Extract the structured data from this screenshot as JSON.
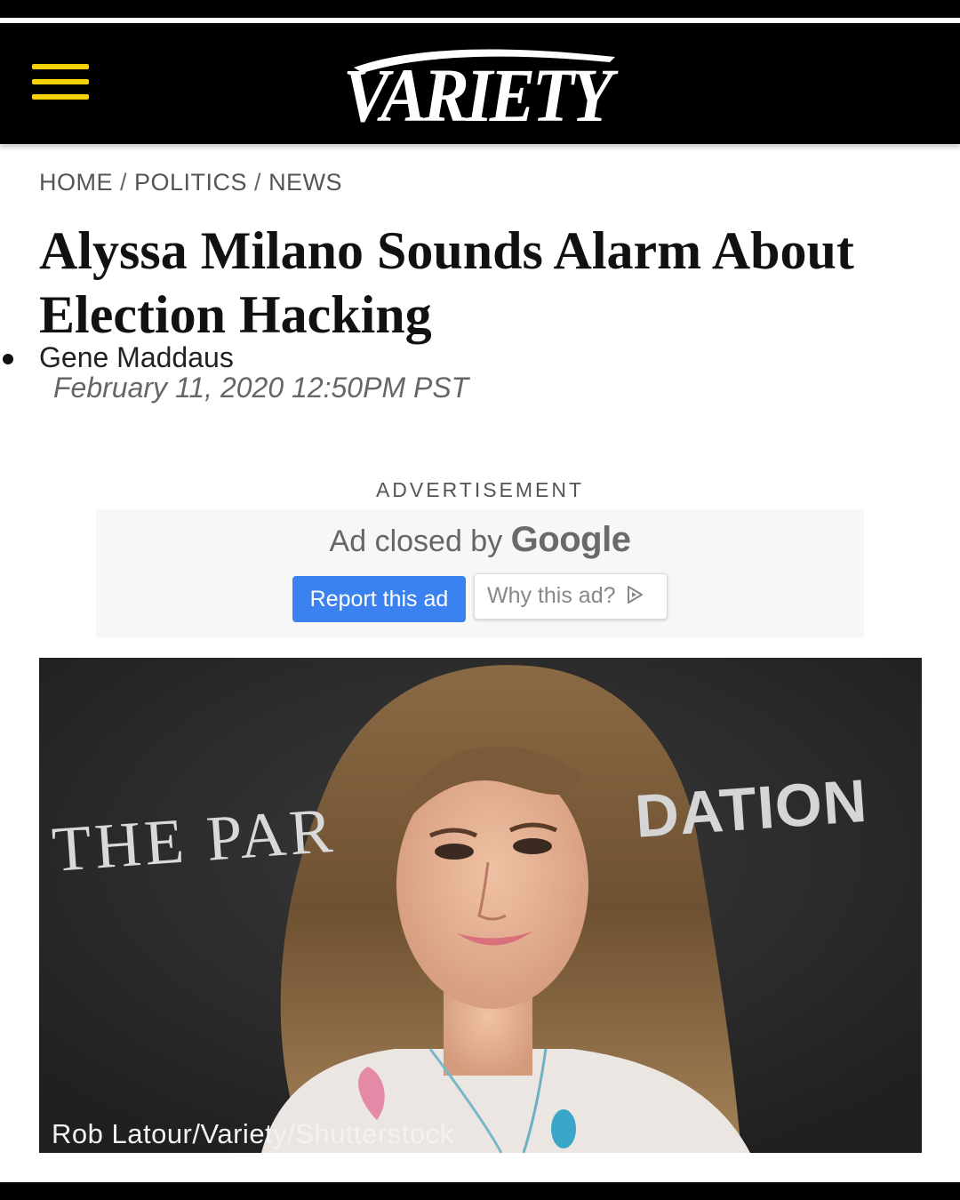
{
  "header": {
    "menu_icon": "hamburger-menu-icon",
    "logo_text": "VARIETY",
    "menu_color": "#f5d20a"
  },
  "breadcrumb": {
    "items": [
      "HOME",
      "POLITICS",
      "NEWS"
    ],
    "separator": "/"
  },
  "article": {
    "title": "Alyssa Milano Sounds Alarm About Election Hacking",
    "author": "Gene Maddaus",
    "date": "February 11, 2020 12:50PM PST"
  },
  "ad": {
    "label": "ADVERTISEMENT",
    "closed_text": "Ad closed by",
    "closed_brand": "Google",
    "report_button": "Report this ad",
    "why_button": "Why this ad?",
    "why_icon": "adchoices-play-icon",
    "report_button_color": "#3b82f0"
  },
  "photo": {
    "subject": "woman with long wavy hair at event backdrop",
    "backdrop_text_left": "THE PAR",
    "backdrop_text_right": "DATION",
    "credit": "Rob Latour/Variety/Shutterstock"
  }
}
